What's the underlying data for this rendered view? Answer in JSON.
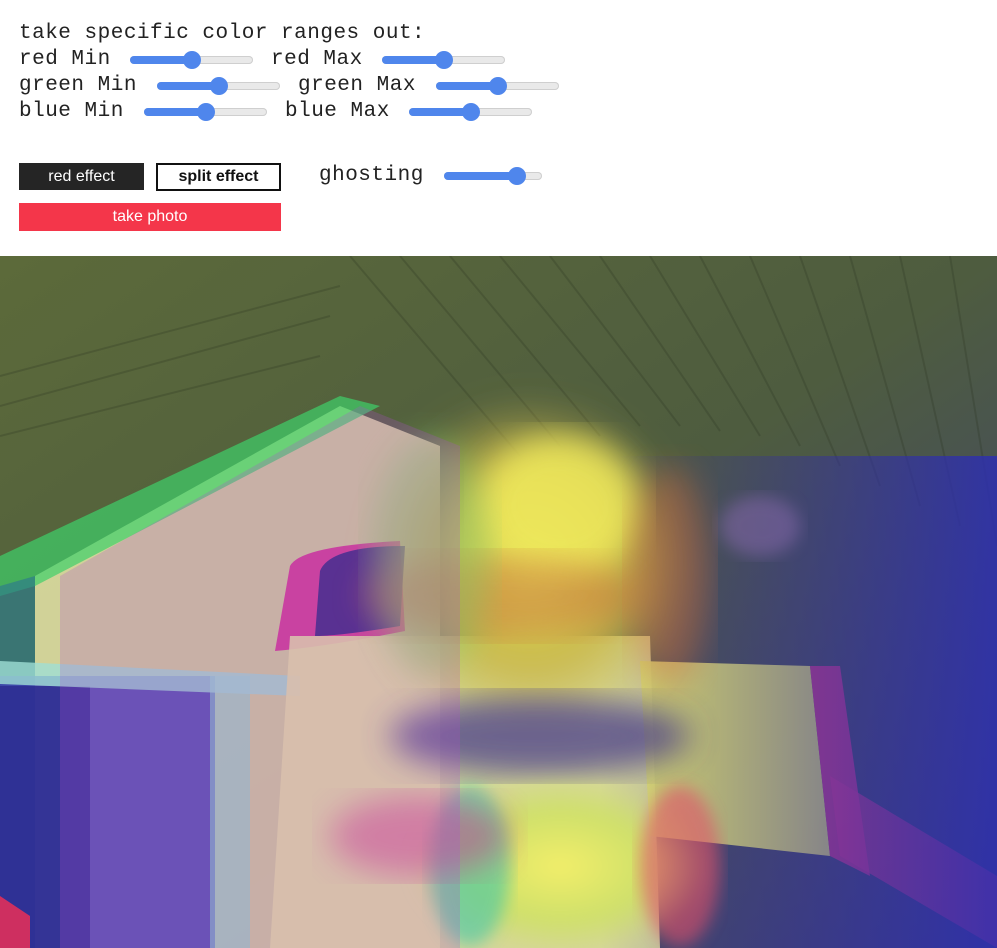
{
  "heading": "take specific color ranges out:",
  "sliders": {
    "red_min": {
      "label": "red Min",
      "value": 0.5
    },
    "red_max": {
      "label": "red Max",
      "value": 0.5
    },
    "green_min": {
      "label": "green Min",
      "value": 0.5
    },
    "green_max": {
      "label": "green Max",
      "value": 0.5
    },
    "blue_min": {
      "label": "blue Min",
      "value": 0.5
    },
    "blue_max": {
      "label": "blue Max",
      "value": 0.5
    },
    "ghosting": {
      "label": "ghosting",
      "value": 0.8
    }
  },
  "buttons": {
    "red_effect": "red effect",
    "split_effect": "split effect",
    "take_photo": "take photo"
  },
  "colors": {
    "slider_accent": "#4f86ec",
    "take_photo_bg": "#f4364a",
    "red_effect_bg": "#252525"
  }
}
